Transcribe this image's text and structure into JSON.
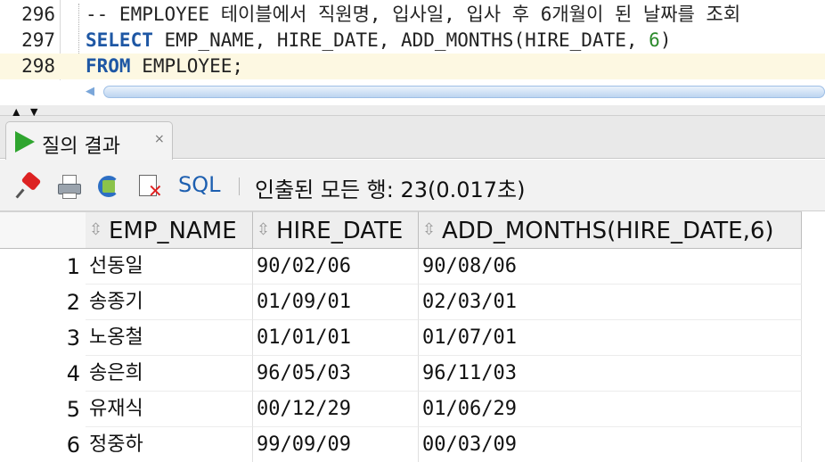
{
  "editor": {
    "lines": [
      {
        "num": "296",
        "comment": "-- EMPLOYEE 테이블에서 직원명, 입사일, 입사 후 6개월이 된 날짜를 조회"
      },
      {
        "num": "297",
        "kw": "SELECT",
        "rest": " EMP_NAME, HIRE_DATE, ADD_MONTHS(HIRE_DATE, ",
        "number": "6",
        "tail": ")"
      },
      {
        "num": "298",
        "kw": "FROM",
        "rest": " EMPLOYEE;"
      }
    ]
  },
  "results_tab": {
    "label": "질의 결과",
    "close": "×"
  },
  "toolbar": {
    "sql_label": "SQL",
    "fetch_status": "인출된 모든 행: 23(0.017초)"
  },
  "grid": {
    "columns": [
      "EMP_NAME",
      "HIRE_DATE",
      "ADD_MONTHS(HIRE_DATE,6)"
    ],
    "rows": [
      {
        "n": "1",
        "name": "선동일",
        "hire": "90/02/06",
        "add": "90/08/06"
      },
      {
        "n": "2",
        "name": "송종기",
        "hire": "01/09/01",
        "add": "02/03/01"
      },
      {
        "n": "3",
        "name": "노옹철",
        "hire": "01/01/01",
        "add": "01/07/01"
      },
      {
        "n": "4",
        "name": "송은희",
        "hire": "96/05/03",
        "add": "96/11/03"
      },
      {
        "n": "5",
        "name": "유재식",
        "hire": "00/12/29",
        "add": "01/06/29"
      },
      {
        "n": "6",
        "name": "정중하",
        "hire": "99/09/09",
        "add": "00/03/09"
      }
    ]
  },
  "colors": {
    "keyword": "#1e57a4",
    "comment": "#8d8d8d",
    "number_literal": "#2b8a2b",
    "current_line": "#fdf8e2",
    "run_icon": "#2fa52f"
  }
}
